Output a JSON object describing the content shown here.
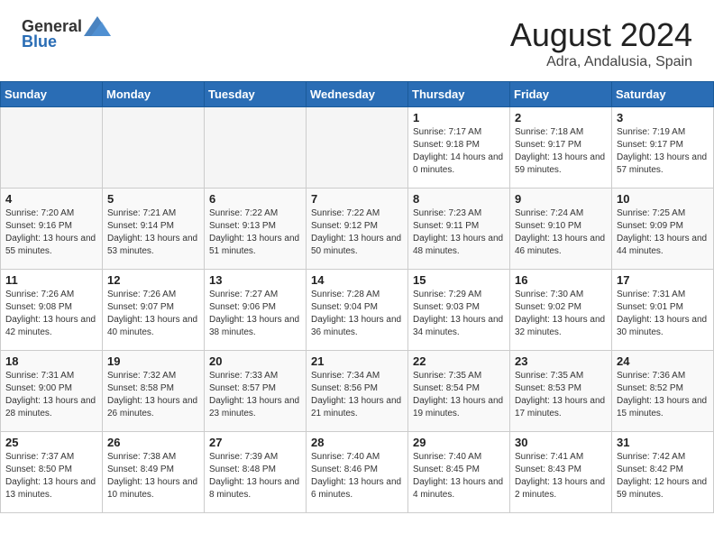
{
  "header": {
    "logo_general": "General",
    "logo_blue": "Blue",
    "month_year": "August 2024",
    "location": "Adra, Andalusia, Spain"
  },
  "weekdays": [
    "Sunday",
    "Monday",
    "Tuesday",
    "Wednesday",
    "Thursday",
    "Friday",
    "Saturday"
  ],
  "weeks": [
    [
      {
        "day": "",
        "empty": true
      },
      {
        "day": "",
        "empty": true
      },
      {
        "day": "",
        "empty": true
      },
      {
        "day": "",
        "empty": true
      },
      {
        "day": "1",
        "sunrise": "7:17 AM",
        "sunset": "9:18 PM",
        "daylight": "Daylight: 14 hours and 0 minutes."
      },
      {
        "day": "2",
        "sunrise": "7:18 AM",
        "sunset": "9:17 PM",
        "daylight": "Daylight: 13 hours and 59 minutes."
      },
      {
        "day": "3",
        "sunrise": "7:19 AM",
        "sunset": "9:17 PM",
        "daylight": "Daylight: 13 hours and 57 minutes."
      }
    ],
    [
      {
        "day": "4",
        "sunrise": "7:20 AM",
        "sunset": "9:16 PM",
        "daylight": "Daylight: 13 hours and 55 minutes."
      },
      {
        "day": "5",
        "sunrise": "7:21 AM",
        "sunset": "9:14 PM",
        "daylight": "Daylight: 13 hours and 53 minutes."
      },
      {
        "day": "6",
        "sunrise": "7:22 AM",
        "sunset": "9:13 PM",
        "daylight": "Daylight: 13 hours and 51 minutes."
      },
      {
        "day": "7",
        "sunrise": "7:22 AM",
        "sunset": "9:12 PM",
        "daylight": "Daylight: 13 hours and 50 minutes."
      },
      {
        "day": "8",
        "sunrise": "7:23 AM",
        "sunset": "9:11 PM",
        "daylight": "Daylight: 13 hours and 48 minutes."
      },
      {
        "day": "9",
        "sunrise": "7:24 AM",
        "sunset": "9:10 PM",
        "daylight": "Daylight: 13 hours and 46 minutes."
      },
      {
        "day": "10",
        "sunrise": "7:25 AM",
        "sunset": "9:09 PM",
        "daylight": "Daylight: 13 hours and 44 minutes."
      }
    ],
    [
      {
        "day": "11",
        "sunrise": "7:26 AM",
        "sunset": "9:08 PM",
        "daylight": "Daylight: 13 hours and 42 minutes."
      },
      {
        "day": "12",
        "sunrise": "7:26 AM",
        "sunset": "9:07 PM",
        "daylight": "Daylight: 13 hours and 40 minutes."
      },
      {
        "day": "13",
        "sunrise": "7:27 AM",
        "sunset": "9:06 PM",
        "daylight": "Daylight: 13 hours and 38 minutes."
      },
      {
        "day": "14",
        "sunrise": "7:28 AM",
        "sunset": "9:04 PM",
        "daylight": "Daylight: 13 hours and 36 minutes."
      },
      {
        "day": "15",
        "sunrise": "7:29 AM",
        "sunset": "9:03 PM",
        "daylight": "Daylight: 13 hours and 34 minutes."
      },
      {
        "day": "16",
        "sunrise": "7:30 AM",
        "sunset": "9:02 PM",
        "daylight": "Daylight: 13 hours and 32 minutes."
      },
      {
        "day": "17",
        "sunrise": "7:31 AM",
        "sunset": "9:01 PM",
        "daylight": "Daylight: 13 hours and 30 minutes."
      }
    ],
    [
      {
        "day": "18",
        "sunrise": "7:31 AM",
        "sunset": "9:00 PM",
        "daylight": "Daylight: 13 hours and 28 minutes."
      },
      {
        "day": "19",
        "sunrise": "7:32 AM",
        "sunset": "8:58 PM",
        "daylight": "Daylight: 13 hours and 26 minutes."
      },
      {
        "day": "20",
        "sunrise": "7:33 AM",
        "sunset": "8:57 PM",
        "daylight": "Daylight: 13 hours and 23 minutes."
      },
      {
        "day": "21",
        "sunrise": "7:34 AM",
        "sunset": "8:56 PM",
        "daylight": "Daylight: 13 hours and 21 minutes."
      },
      {
        "day": "22",
        "sunrise": "7:35 AM",
        "sunset": "8:54 PM",
        "daylight": "Daylight: 13 hours and 19 minutes."
      },
      {
        "day": "23",
        "sunrise": "7:35 AM",
        "sunset": "8:53 PM",
        "daylight": "Daylight: 13 hours and 17 minutes."
      },
      {
        "day": "24",
        "sunrise": "7:36 AM",
        "sunset": "8:52 PM",
        "daylight": "Daylight: 13 hours and 15 minutes."
      }
    ],
    [
      {
        "day": "25",
        "sunrise": "7:37 AM",
        "sunset": "8:50 PM",
        "daylight": "Daylight: 13 hours and 13 minutes."
      },
      {
        "day": "26",
        "sunrise": "7:38 AM",
        "sunset": "8:49 PM",
        "daylight": "Daylight: 13 hours and 10 minutes."
      },
      {
        "day": "27",
        "sunrise": "7:39 AM",
        "sunset": "8:48 PM",
        "daylight": "Daylight: 13 hours and 8 minutes."
      },
      {
        "day": "28",
        "sunrise": "7:40 AM",
        "sunset": "8:46 PM",
        "daylight": "Daylight: 13 hours and 6 minutes."
      },
      {
        "day": "29",
        "sunrise": "7:40 AM",
        "sunset": "8:45 PM",
        "daylight": "Daylight: 13 hours and 4 minutes."
      },
      {
        "day": "30",
        "sunrise": "7:41 AM",
        "sunset": "8:43 PM",
        "daylight": "Daylight: 13 hours and 2 minutes."
      },
      {
        "day": "31",
        "sunrise": "7:42 AM",
        "sunset": "8:42 PM",
        "daylight": "Daylight: 12 hours and 59 minutes."
      }
    ]
  ]
}
